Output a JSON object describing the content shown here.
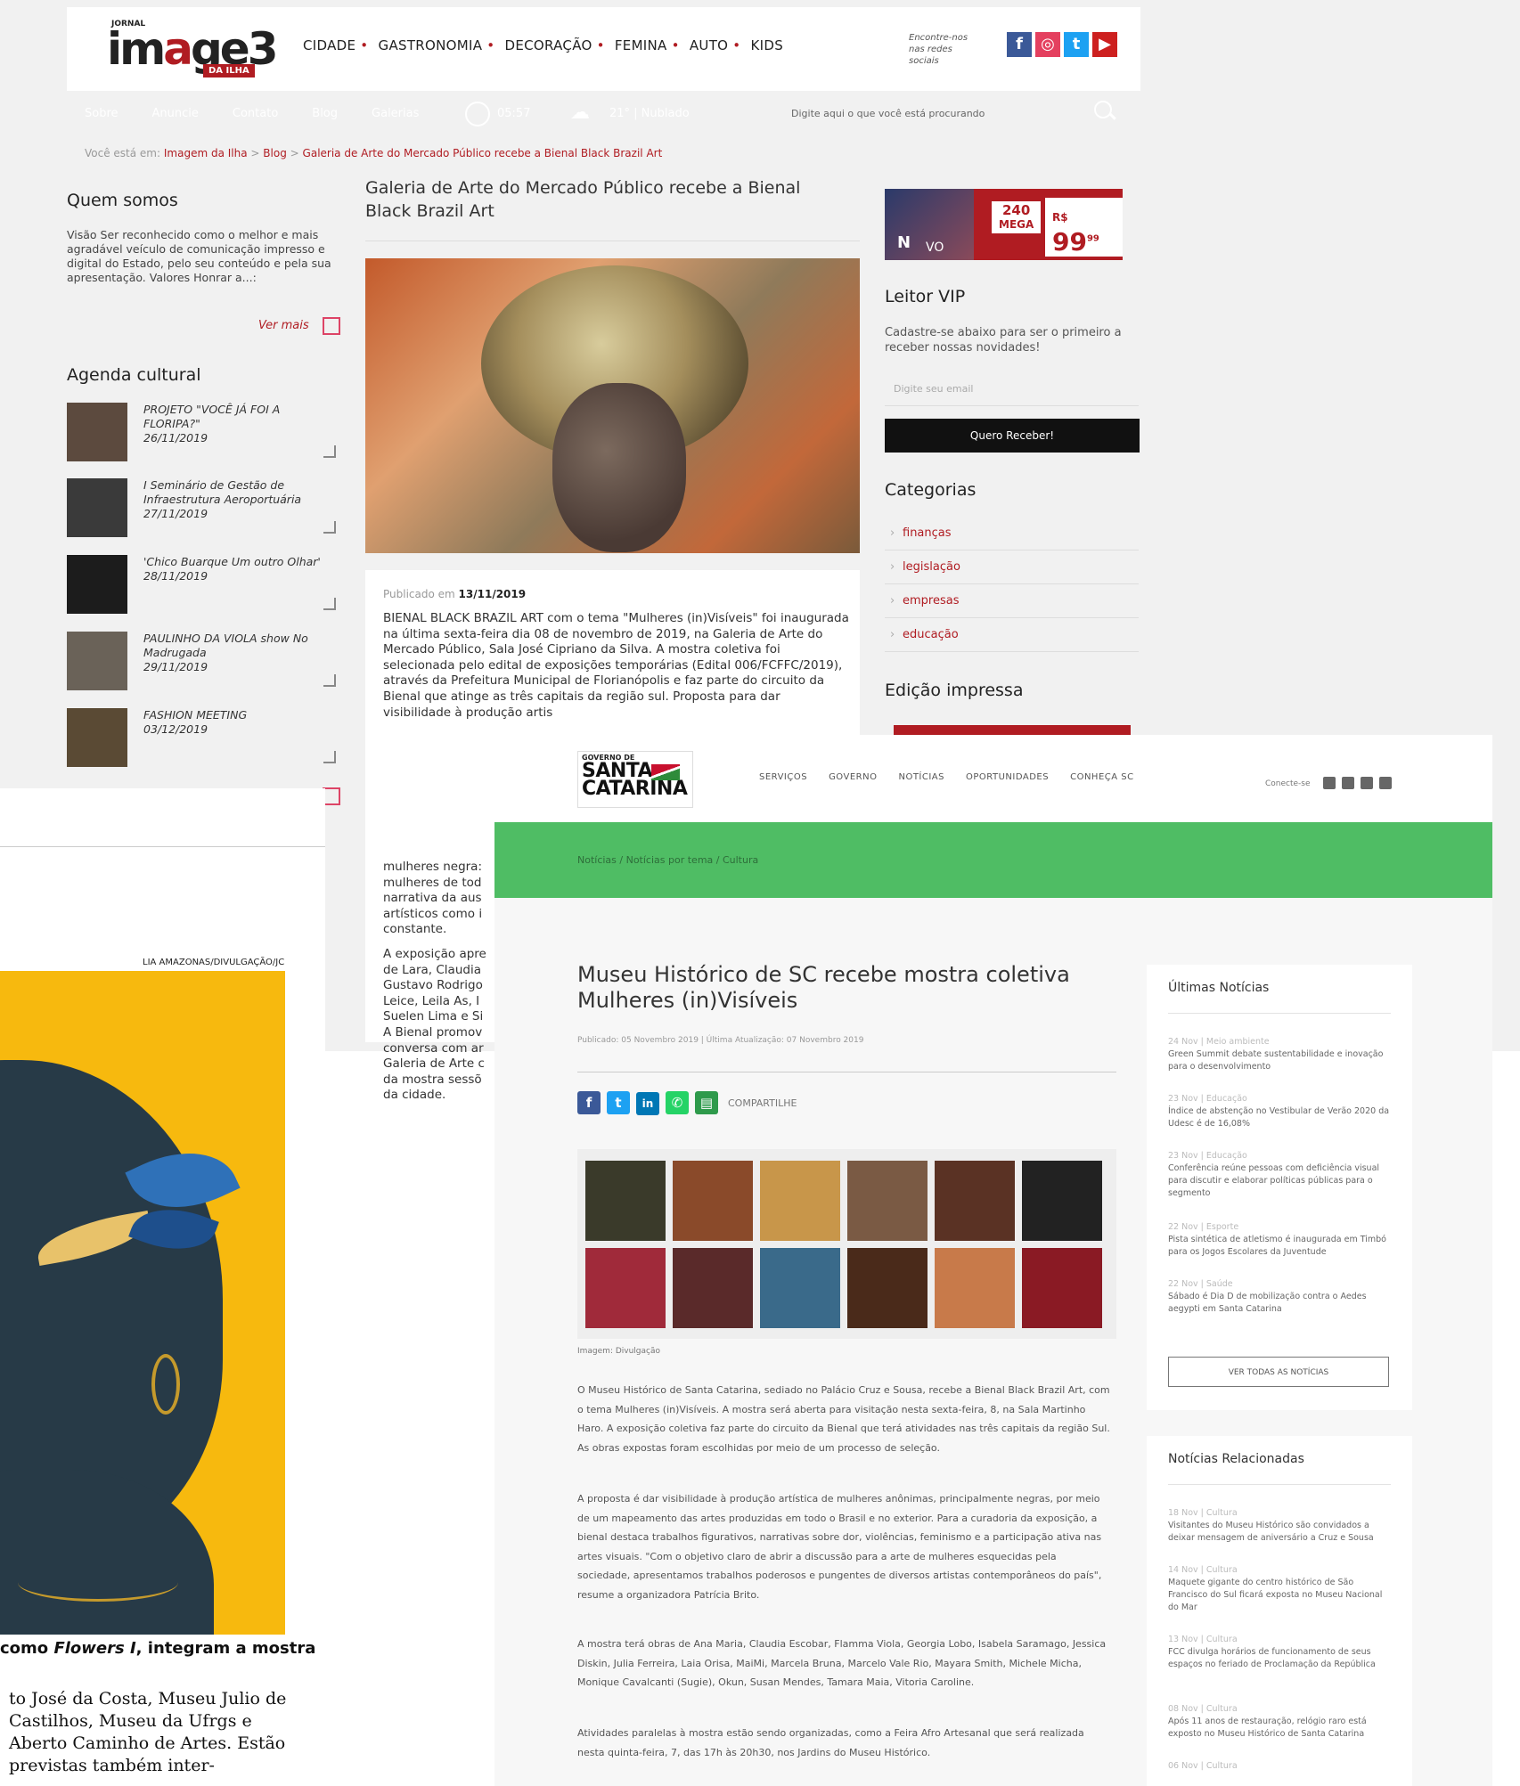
{
  "page1": {
    "logo": {
      "small": "JORNAL",
      "main_a": "im",
      "main_b": "a",
      "main_c": "ge",
      "main_d": "3",
      "tag": "DA ILHA"
    },
    "topnav": [
      "CIDADE",
      "GASTRONOMIA",
      "DECORAÇÃO",
      "FEMINA",
      "AUTO",
      "KIDS"
    ],
    "topnav_sep": "•",
    "social_text": "Encontre-nos nas redes sociais",
    "social_icons": [
      {
        "name": "facebook-icon",
        "glyph": "f",
        "color": "#3b5998"
      },
      {
        "name": "instagram-icon",
        "glyph": "◎",
        "color": "#e4405f"
      },
      {
        "name": "twitter-icon",
        "glyph": "t",
        "color": "#1da1f2"
      },
      {
        "name": "youtube-icon",
        "glyph": "▶",
        "color": "#cd201f"
      }
    ],
    "rednav": [
      "Sobre",
      "Anuncie",
      "Contato",
      "Blog",
      "Galerias"
    ],
    "time": "05:57",
    "weather": "21° | Nublado",
    "search_placeholder": "Digite aqui o que você está procurando",
    "breadcrumb": {
      "prefix": "Você está em:",
      "items": [
        "Imagem da Ilha",
        "Blog",
        "Galeria de Arte do Mercado Público recebe a Bienal Black Brazil Art"
      ],
      "sep": ">"
    },
    "quem_somos": {
      "title": "Quem somos",
      "text": "Visão Ser reconhecido como o melhor e mais agradável veículo de comunicação impresso e digital do Estado, pelo seu conteúdo e pela sua apresentação. Valores Honrar a...:",
      "more": "Ver mais"
    },
    "agenda": {
      "title": "Agenda cultural",
      "items": [
        {
          "title": "PROJETO \"VOCÊ JÁ FOI A FLORIPA?\"",
          "date": "26/11/2019",
          "color": "#5c4a3e"
        },
        {
          "title": "I Seminário de Gestão de Infraestrutura Aeroportuária",
          "date": "27/11/2019",
          "color": "#3a3a3a"
        },
        {
          "title": "'Chico Buarque Um outro Olhar'",
          "date": "28/11/2019",
          "color": "#1c1c1c"
        },
        {
          "title": "PAULINHO DA VIOLA show No Madrugada",
          "date": "29/11/2019",
          "color": "#6a6258"
        },
        {
          "title": "FASHION MEETING",
          "date": "03/12/2019",
          "color": "#5a4a34"
        }
      ]
    },
    "article": {
      "title": "Galeria de Arte do Mercado Público recebe a Bienal Black Brazil Art",
      "published_label": "Publicado em",
      "published_date": "13/11/2019",
      "body": "BIENAL BLACK BRAZIL ART com o tema \"Mulheres (in)Visíveis\" foi inaugurada na última sexta-feira dia 08 de novembro de 2019, na Galeria de Arte do Mercado Público, Sala José Cipriano da Silva. A mostra coletiva foi selecionada pelo edital de exposições temporárias (Edital 006/FCFFC/2019), através da Prefeitura Municipal de Florianópolis e faz parte do circuito da Bienal que atinge as três capitais da região sul. Proposta para dar visibilidade à produção artis",
      "body_cut": [
        "mulheres negra:",
        "mulheres de tod",
        "narrativa da aus",
        "artísticos como i",
        "constante.",
        "",
        "A exposição apre",
        "de Lara, Claudia",
        "Gustavo Rodrigo",
        "Leice, Leila As, I",
        "Suelen Lima e Si",
        "A Bienal promov",
        "conversa com ar",
        "Galeria de Arte c",
        "da mostra sessõ",
        "da cidade."
      ]
    },
    "ad": {
      "n": "N",
      "vo": "VO",
      "line1": "240",
      "line2": "MEGA",
      "rs": "R$",
      "price": "99",
      "cents": "99"
    },
    "leitor_vip": {
      "title": "Leitor VIP",
      "text": "Cadastre-se abaixo para ser o primeiro a receber nossas novidades!",
      "placeholder": "Digite seu email",
      "button": "Quero Receber!"
    },
    "categorias": {
      "title": "Categorias",
      "items": [
        "finanças",
        "legislação",
        "empresas",
        "educação"
      ]
    },
    "edicao": "Edição impressa"
  },
  "page2": {
    "credit": "LIA AMAZONAS/DIVULGAÇÃO/JC",
    "caption_before": "como ",
    "caption_italic": "Flowers I",
    "caption_after": ", integram a mostra",
    "body": "to José da Costa, Museu Julio de Castilhos, Museu da Ufrgs e Aberto Caminho de Artes. Estão previstas também inter-"
  },
  "page3": {
    "logo": {
      "top": "GOVERNO DE",
      "main": "SANTA CATARINA"
    },
    "nav": [
      "SERVIÇOS",
      "GOVERNO",
      "NOTÍCIAS",
      "OPORTUNIDADES",
      "CONHEÇA SC"
    ],
    "social_text": "Conecte-se",
    "breadcrumb": "Notícias / Notícias por tema / Cultura",
    "title": "Museu Histórico de SC recebe mostra coletiva Mulheres (in)Visíveis",
    "meta": "Publicado: 05 Novembro 2019 | Última Atualização: 07 Novembro 2019",
    "share_label": "COMPARTILHE",
    "share_icons": [
      {
        "name": "facebook-icon",
        "glyph": "f",
        "color": "#3b5998"
      },
      {
        "name": "twitter-icon",
        "glyph": "t",
        "color": "#1da1f2"
      },
      {
        "name": "linkedin-icon",
        "glyph": "in",
        "color": "#0077b5"
      },
      {
        "name": "whatsapp-icon",
        "glyph": "✆",
        "color": "#25d366"
      },
      {
        "name": "print-icon",
        "glyph": "▤",
        "color": "#2e9a4b"
      }
    ],
    "gallery_colors": [
      "#3a3a2a",
      "#8a4a2a",
      "#c8964a",
      "#7a5a44",
      "#5a3224",
      "#222222",
      "#a02a3a",
      "#5a2a2a",
      "#3a6a8a",
      "#4a2a1a",
      "#c87a4a",
      "#8a1a24"
    ],
    "image_credit": "Imagem: Divulgação",
    "paragraphs": [
      "O Museu Histórico de Santa Catarina, sediado no Palácio Cruz e Sousa, recebe a Bienal Black Brazil Art, com o tema Mulheres (in)Visíveis. A mostra será aberta para visitação nesta sexta-feira, 8, na Sala Martinho Haro. A exposição coletiva faz parte do circuito da Bienal que terá atividades nas três capitais da região Sul. As obras expostas foram escolhidas por meio de um processo de seleção.",
      "A proposta é dar visibilidade à produção artística de mulheres anônimas, principalmente negras, por meio de um mapeamento das artes produzidas em todo o Brasil e no exterior. Para a curadoria da exposição, a bienal destaca trabalhos figurativos, narrativas sobre dor, violências, feminismo e a participação ativa nas artes visuais. \"Com o objetivo claro de abrir a discussão para a arte de mulheres esquecidas pela sociedade, apresentamos trabalhos poderosos e pungentes de diversos artistas contemporâneos do país\", resume a organizadora Patrícia Brito.",
      "A mostra terá obras de Ana Maria, Claudia Escobar, Flamma Viola, Georgia Lobo, Isabela Saramago, Jessica Diskin, Julia Ferreira, Laia Orisa, MaiMi, Marcela Bruna, Marcelo Vale Rio, Mayara Smith, Michele Micha, Monique Cavalcanti (Sugie), Okun, Susan Mendes, Tamara Maia, Vitoria Caroline.",
      "Atividades paralelas à mostra estão sendo organizadas, como a Feira Afro Artesanal que será realizada nesta quinta-feira, 7, das 17h às 20h30, nos Jardins do Museu Histórico."
    ],
    "ultimas": {
      "title": "Últimas Notícias",
      "items": [
        {
          "date": "24 Nov | Meio ambiente",
          "text": "Green Summit debate sustentabilidade e inovação para o desenvolvimento"
        },
        {
          "date": "23 Nov | Educação",
          "text": "Índice de abstenção no Vestibular de Verão 2020 da Udesc é de 16,08%"
        },
        {
          "date": "23 Nov | Educação",
          "text": "Conferência reúne pessoas com deficiência visual para discutir e elaborar políticas públicas para o segmento"
        },
        {
          "date": "22 Nov | Esporte",
          "text": "Pista sintética de atletismo é inaugurada em Timbó para os Jogos Escolares da Juventude"
        },
        {
          "date": "22 Nov | Saúde",
          "text": "Sábado é Dia D de mobilização contra o Aedes aegypti em Santa Catarina"
        }
      ],
      "button": "VER TODAS AS NOTÍCIAS"
    },
    "relacionadas": {
      "title": "Notícias Relacionadas",
      "items": [
        {
          "date": "18 Nov | Cultura",
          "text": "Visitantes do Museu Histórico são convidados a deixar mensagem de aniversário a Cruz e Sousa"
        },
        {
          "date": "14 Nov | Cultura",
          "text": "Maquete gigante do centro histórico de São Francisco do Sul ficará exposta no Museu Nacional do Mar"
        },
        {
          "date": "13 Nov | Cultura",
          "text": "FCC divulga horários de funcionamento de seus espaços no feriado de Proclamação da República"
        },
        {
          "date": "08 Nov | Cultura",
          "text": "Após 11 anos de restauração, relógio raro está exposto no Museu Histórico de Santa Catarina"
        },
        {
          "date": "06 Nov | Cultura",
          "text": ""
        }
      ]
    }
  }
}
